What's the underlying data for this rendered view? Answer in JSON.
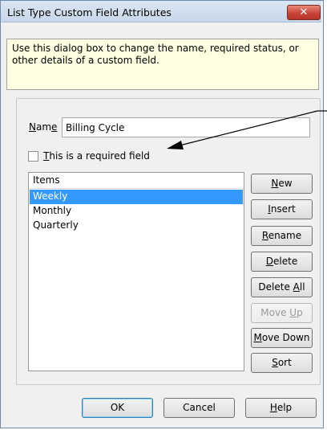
{
  "window": {
    "title": "List Type Custom Field Attributes",
    "close_glyph": "✕"
  },
  "info": {
    "text": "Use this dialog box to change the name, required status, or other details of a custom field."
  },
  "name_field": {
    "label": "Name",
    "value": "Billing Cycle"
  },
  "required_checkbox": {
    "label": "This is a required field",
    "checked": false
  },
  "items_list": {
    "header": "Items",
    "items": [
      "Weekly",
      "Monthly",
      "Quarterly"
    ],
    "selected": "Weekly"
  },
  "side_buttons": {
    "new": "New",
    "insert": "Insert",
    "rename": "Rename",
    "delete": "Delete",
    "delete_all": "Delete All",
    "move_up": "Move Up",
    "move_down": "Move Down",
    "sort": "Sort"
  },
  "bottom_buttons": {
    "ok": "OK",
    "cancel": "Cancel",
    "help": "Help"
  },
  "colors": {
    "selection": "#3399ff",
    "info_bg": "#ffffe1",
    "close_red": "#c8453a"
  }
}
